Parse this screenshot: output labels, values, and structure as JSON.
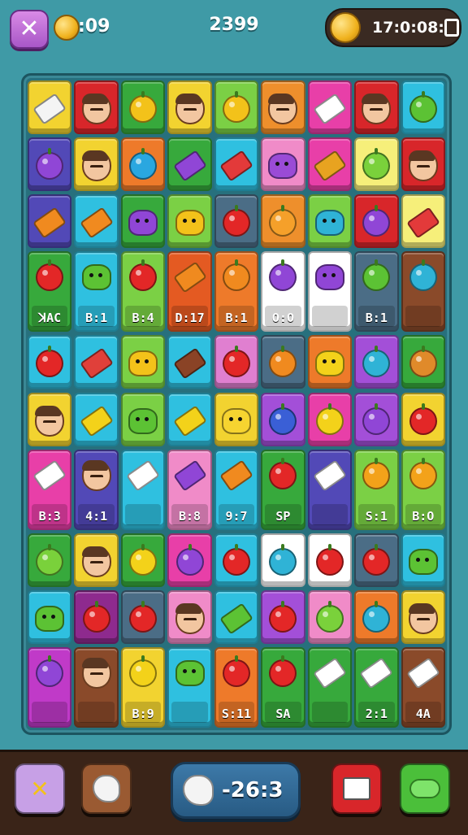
{
  "topbar": {
    "close_label": "✕",
    "timer": ":09",
    "score": "2399",
    "clock": "17:0:08:",
    "icons": [
      "close-icon",
      "coin-icon",
      "coin-icon",
      "lock-icon"
    ]
  },
  "board": {
    "columns": 9,
    "rows": [
      [
        {
          "color": "#f2d330",
          "icon": "candy",
          "ic": "#f4f4f4"
        },
        {
          "color": "#d8262a",
          "icon": "face",
          "ic": ""
        },
        {
          "color": "#37a93c",
          "icon": "fruit",
          "ic": "#f3c21a"
        },
        {
          "color": "#f2d330",
          "icon": "face",
          "ic": ""
        },
        {
          "color": "#7bd045",
          "icon": "fruit",
          "ic": "#f3c21a"
        },
        {
          "color": "#ee8f2c",
          "icon": "face",
          "ic": ""
        },
        {
          "color": "#e83fa8",
          "icon": "candy",
          "ic": "#ffffff"
        },
        {
          "color": "#d8262a",
          "icon": "face",
          "ic": ""
        },
        {
          "color": "#2fc0e0",
          "icon": "fruit",
          "ic": "#5cc234"
        }
      ],
      [
        {
          "color": "#5249b7",
          "icon": "fruit",
          "ic": "#9046d6"
        },
        {
          "color": "#f2d330",
          "icon": "face",
          "ic": ""
        },
        {
          "color": "#ee7a2a",
          "icon": "fruit",
          "ic": "#2aa7e0"
        },
        {
          "color": "#37a93c",
          "icon": "candy",
          "ic": "#9046d6"
        },
        {
          "color": "#2fc0e0",
          "icon": "candy",
          "ic": "#e33a3a"
        },
        {
          "color": "#f08bc8",
          "icon": "slime",
          "ic": "#9a4bd6"
        },
        {
          "color": "#e83fa8",
          "icon": "candy",
          "ic": "#e8a320"
        },
        {
          "color": "#f6ef7a",
          "icon": "fruit",
          "ic": "#7ad13b"
        },
        {
          "color": "#d8262a",
          "icon": "face",
          "ic": ""
        }
      ],
      [
        {
          "color": "#5249b7",
          "icon": "candy",
          "ic": "#f08a1f"
        },
        {
          "color": "#2fc0e0",
          "icon": "candy",
          "ic": "#f08a1f"
        },
        {
          "color": "#37a93c",
          "icon": "slime",
          "ic": "#9046d6"
        },
        {
          "color": "#7bd045",
          "icon": "slime",
          "ic": "#f3c21a"
        },
        {
          "color": "#4b6d86",
          "icon": "fruit",
          "ic": "#e32727"
        },
        {
          "color": "#ee8f2c",
          "icon": "fruit",
          "ic": "#f5a02a"
        },
        {
          "color": "#7bd045",
          "icon": "slime",
          "ic": "#2fb3d6"
        },
        {
          "color": "#d8262a",
          "icon": "fruit",
          "ic": "#9046d6"
        },
        {
          "color": "#f6ef7a",
          "icon": "candy",
          "ic": "#e33a3a"
        }
      ],
      [
        {
          "color": "#37a93c",
          "icon": "fruit",
          "ic": "#e32727",
          "label": "ꓘAC"
        },
        {
          "color": "#2fc0e0",
          "icon": "slime",
          "ic": "#5cc234",
          "label": "B:1"
        },
        {
          "color": "#7bd045",
          "icon": "fruit",
          "ic": "#e32727",
          "label": "B:4"
        },
        {
          "color": "#e45a22",
          "icon": "candy",
          "ic": "#f08a1f",
          "label": "D:17"
        },
        {
          "color": "#ee7a2a",
          "icon": "fruit",
          "ic": "#f08a1f",
          "label": "B:1"
        },
        {
          "color": "#ffffff",
          "icon": "fruit",
          "ic": "#9046d6",
          "label": "O:O"
        },
        {
          "color": "#ffffff",
          "icon": "slime",
          "ic": "#9046d6",
          "label": ""
        },
        {
          "color": "#4b6d86",
          "icon": "fruit",
          "ic": "#5cc234",
          "label": "B:1"
        },
        {
          "color": "#8a4a2a",
          "icon": "fruit",
          "ic": "#2fb3d6",
          "label": ""
        }
      ],
      [
        {
          "color": "#2fc0e0",
          "icon": "fruit",
          "ic": "#e32727"
        },
        {
          "color": "#2fc0e0",
          "icon": "candy",
          "ic": "#e0403a"
        },
        {
          "color": "#7bd045",
          "icon": "slime",
          "ic": "#f3c21a"
        },
        {
          "color": "#2fc0e0",
          "icon": "candy",
          "ic": "#8a4326"
        },
        {
          "color": "#e07fd0",
          "icon": "fruit",
          "ic": "#e32727"
        },
        {
          "color": "#4b6d86",
          "icon": "fruit",
          "ic": "#f08a1f"
        },
        {
          "color": "#ee7a2a",
          "icon": "slime",
          "ic": "#f3d21a"
        },
        {
          "color": "#a34fd8",
          "icon": "fruit",
          "ic": "#2fb3d6"
        },
        {
          "color": "#37a93c",
          "icon": "fruit",
          "ic": "#e08a2a"
        }
      ],
      [
        {
          "color": "#f2d330",
          "icon": "face",
          "ic": ""
        },
        {
          "color": "#2fc0e0",
          "icon": "candy",
          "ic": "#f3d21a"
        },
        {
          "color": "#7bd045",
          "icon": "slime",
          "ic": "#5cc234"
        },
        {
          "color": "#2fc0e0",
          "icon": "candy",
          "ic": "#f3d21a"
        },
        {
          "color": "#f2d330",
          "icon": "slime",
          "ic": "#f6d430"
        },
        {
          "color": "#a34fd8",
          "icon": "fruit",
          "ic": "#3a5fd6"
        },
        {
          "color": "#e83fa8",
          "icon": "fruit",
          "ic": "#f3d21a"
        },
        {
          "color": "#a34fd8",
          "icon": "fruit",
          "ic": "#9046d6"
        },
        {
          "color": "#f2d330",
          "icon": "fruit",
          "ic": "#e32727"
        }
      ],
      [
        {
          "color": "#e83fa8",
          "icon": "candy",
          "ic": "#ffffff",
          "label": "B:3"
        },
        {
          "color": "#5249b7",
          "icon": "face",
          "ic": "",
          "label": "4:1"
        },
        {
          "color": "#2fc0e0",
          "icon": "candy",
          "ic": "#ffffff",
          "label": ""
        },
        {
          "color": "#f08bc8",
          "icon": "candy",
          "ic": "#9046d6",
          "label": "B:8"
        },
        {
          "color": "#2fc0e0",
          "icon": "candy",
          "ic": "#f08a1f",
          "label": "9:7"
        },
        {
          "color": "#37a93c",
          "icon": "fruit",
          "ic": "#e32727",
          "label": "SP"
        },
        {
          "color": "#5249b7",
          "icon": "candy",
          "ic": "#ffffff",
          "label": ""
        },
        {
          "color": "#7bd045",
          "icon": "fruit",
          "ic": "#f3a21a",
          "label": "S:1"
        },
        {
          "color": "#7bd045",
          "icon": "fruit",
          "ic": "#f3a21a",
          "label": "B:O"
        }
      ],
      [
        {
          "color": "#37a93c",
          "icon": "fruit",
          "ic": "#7ad13b"
        },
        {
          "color": "#f2d330",
          "icon": "face",
          "ic": ""
        },
        {
          "color": "#37a93c",
          "icon": "fruit",
          "ic": "#f3d21a"
        },
        {
          "color": "#e83fa8",
          "icon": "fruit",
          "ic": "#9046d6"
        },
        {
          "color": "#2fc0e0",
          "icon": "fruit",
          "ic": "#e32727"
        },
        {
          "color": "#ffffff",
          "icon": "fruit",
          "ic": "#2fb3d6"
        },
        {
          "color": "#ffffff",
          "icon": "fruit",
          "ic": "#e32727"
        },
        {
          "color": "#4b6d86",
          "icon": "fruit",
          "ic": "#e32727"
        },
        {
          "color": "#2fc0e0",
          "icon": "slime",
          "ic": "#5cc234"
        }
      ],
      [
        {
          "color": "#2fc0e0",
          "icon": "slime",
          "ic": "#5cc234"
        },
        {
          "color": "#8e2a8e",
          "icon": "fruit",
          "ic": "#e32727"
        },
        {
          "color": "#4b6d86",
          "icon": "fruit",
          "ic": "#e32727"
        },
        {
          "color": "#f08bc8",
          "icon": "face",
          "ic": ""
        },
        {
          "color": "#2fc0e0",
          "icon": "candy",
          "ic": "#5cc234"
        },
        {
          "color": "#a34fd8",
          "icon": "fruit",
          "ic": "#e32727"
        },
        {
          "color": "#f08bc8",
          "icon": "fruit",
          "ic": "#7ad13b"
        },
        {
          "color": "#ee7a2a",
          "icon": "fruit",
          "ic": "#2fb3d6"
        },
        {
          "color": "#f2d330",
          "icon": "face",
          "ic": ""
        }
      ],
      [
        {
          "color": "#c03ac8",
          "icon": "fruit",
          "ic": "#9046d6",
          "label": ""
        },
        {
          "color": "#8a4a2a",
          "icon": "face",
          "ic": "",
          "label": ""
        },
        {
          "color": "#f2d330",
          "icon": "fruit",
          "ic": "#f3d21a",
          "label": "B:9"
        },
        {
          "color": "#2fc0e0",
          "icon": "slime",
          "ic": "#5cc234",
          "label": ""
        },
        {
          "color": "#ee7a2a",
          "icon": "fruit",
          "ic": "#e32727",
          "label": "S:11"
        },
        {
          "color": "#37a93c",
          "icon": "fruit",
          "ic": "#e32727",
          "label": "SA"
        },
        {
          "color": "#37a93c",
          "icon": "candy",
          "ic": "#ffffff",
          "label": ""
        },
        {
          "color": "#37a93c",
          "icon": "candy",
          "ic": "#ffffff",
          "label": "2:1"
        },
        {
          "color": "#8a4a2a",
          "icon": "candy",
          "ic": "#ffffff",
          "label": "4A"
        }
      ]
    ]
  },
  "bottombar": {
    "buttons": [
      {
        "name": "shuffle-button",
        "icon": "cross-tools-icon",
        "label": "✕",
        "color": "#c7a0e6"
      },
      {
        "name": "glove-button",
        "icon": "glove-icon",
        "label": "",
        "color": "#9a5a32"
      },
      {
        "name": "card-button",
        "icon": "card-icon",
        "label": "",
        "color": "#d8262a"
      },
      {
        "name": "cloud-button",
        "icon": "cloud-icon",
        "label": "",
        "color": "#4bbf3a"
      }
    ],
    "score": "-26:3"
  }
}
